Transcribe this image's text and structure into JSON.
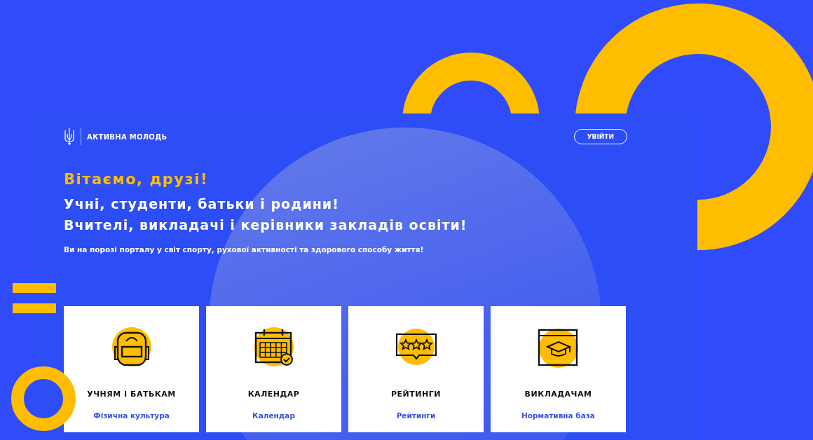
{
  "header": {
    "logo_text": "АКТИВНА МОЛОДЬ",
    "login_button": "УВІЙТИ"
  },
  "greeting": "Вітаємо, друзі!",
  "headlines": [
    "Учні, студенти, батьки і родини!",
    "Вчителі, викладачі і керівники закладів освіти!"
  ],
  "tagline": "Ви на порозі порталу у світ спорту, рухової активності та здорового способу життя!",
  "cards": [
    {
      "kind": "backpack",
      "title": "УЧНЯМ І БАТЬКАМ",
      "link": "Фізична культура"
    },
    {
      "kind": "calendar",
      "title": "КАЛЕНДАР",
      "link": "Календар"
    },
    {
      "kind": "ratings",
      "title": "РЕЙТИНГИ",
      "link": "Рейтинги"
    },
    {
      "kind": "teachers",
      "title": "ВИКЛАДАЧАМ",
      "link": "Нормативна база"
    }
  ]
}
